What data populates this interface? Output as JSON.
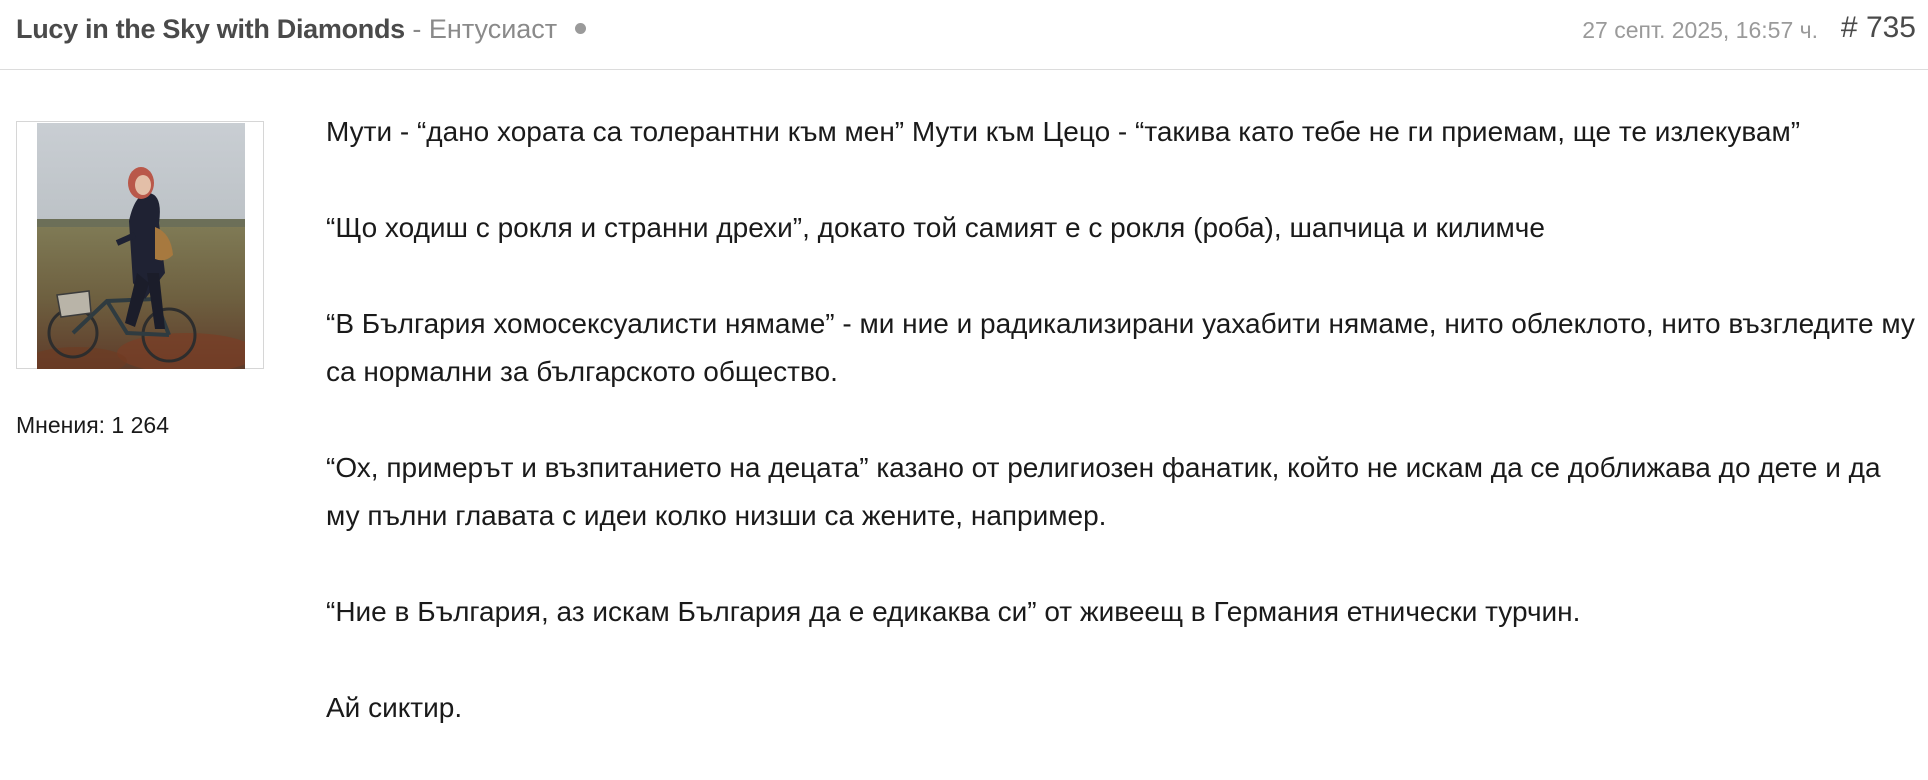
{
  "post": {
    "author": "Lucy in the Sky with Diamonds",
    "separator": "-",
    "rank": "Ентусиаст",
    "date": "27 септ. 2025, 16:57 ч.",
    "number": "# 735"
  },
  "author_panel": {
    "posts_label": "Мнения: 1 264"
  },
  "body": {
    "paragraphs": [
      "Мути - “дано хората са толерантни към мен” Мути към Цецо - “такива като тебе не ги приемам, ще те излекувам”",
      "“Що ходиш с рокля и странни дрехи”, докато той самият е с рокля (роба), шапчица и килимче",
      "“В България хомосексуалисти нямаме” - ми ние и радикализирани уахабити нямаме, нито облеклото, нито възгледите му са нормални за българското общество.",
      "“Ох, примерът и възпитанието на децата” казано от религиозен фанатик, който не искам да се доближава до дете и да му пълни главата с идеи колко низши са жените, например.",
      "“Ние в България, аз искам България да е едикаква си” от живеещ в Германия етнически турчин.",
      "Ай сиктир."
    ]
  },
  "colors": {
    "author": "#4a4a4a",
    "muted": "#8a8a8a",
    "divider": "#dcdcdc",
    "text": "#1a1a1a"
  },
  "icons": {
    "status": "status-dot-icon"
  }
}
